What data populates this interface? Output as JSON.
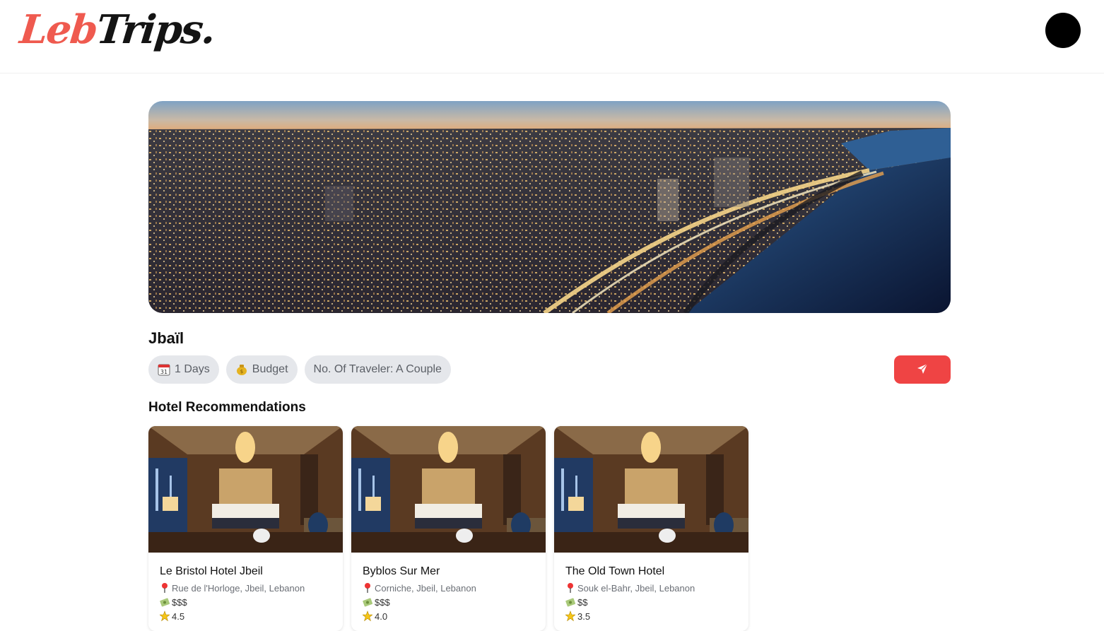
{
  "header": {
    "logo_part1": "Leb",
    "logo_part2": "Trips."
  },
  "trip": {
    "title": "Jbaïl",
    "chips": [
      {
        "icon": "calendar-icon",
        "label": "1 Days"
      },
      {
        "icon": "money-bag-icon",
        "label": "Budget"
      },
      {
        "label": "No. Of Traveler: A Couple"
      }
    ],
    "share_icon": "send-icon"
  },
  "hotels": {
    "section_title": "Hotel Recommendations",
    "items": [
      {
        "name": "Le Bristol Hotel Jbeil",
        "address": "Rue de l'Horloge, Jbeil, Lebanon",
        "price": "$$$",
        "rating": "4.5"
      },
      {
        "name": "Byblos Sur Mer",
        "address": "Corniche, Jbeil, Lebanon",
        "price": "$$$",
        "rating": "4.0"
      },
      {
        "name": "The Old Town Hotel",
        "address": "Souk el-Bahr, Jbeil, Lebanon",
        "price": "$$",
        "rating": "3.5"
      }
    ]
  },
  "colors": {
    "accent": "#ef4444",
    "logo_red": "#ef5a4f",
    "chip_bg": "#e5e7eb"
  }
}
